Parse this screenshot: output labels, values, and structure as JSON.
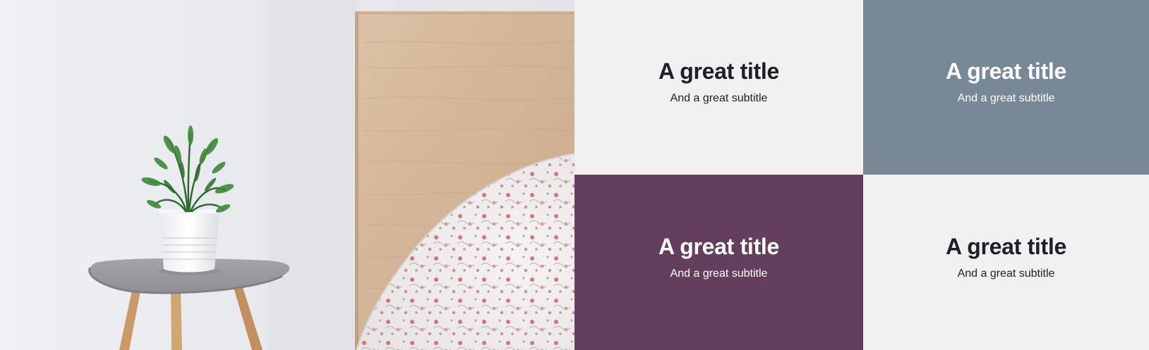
{
  "colors": {
    "tile_light": "#f0f0f0",
    "tile_slate": "#798897",
    "tile_plum": "#643f5d",
    "text_dark": "#1e2029",
    "text_light": "#ffffff"
  },
  "photo": {
    "icon": "bedroom-photo"
  },
  "tiles": [
    {
      "title": "A great title",
      "subtitle": "And a great subtitle"
    },
    {
      "title": "A great title",
      "subtitle": "And a great subtitle"
    },
    {
      "title": "A great title",
      "subtitle": "And a great subtitle"
    },
    {
      "title": "A great title",
      "subtitle": "And a great subtitle"
    }
  ]
}
